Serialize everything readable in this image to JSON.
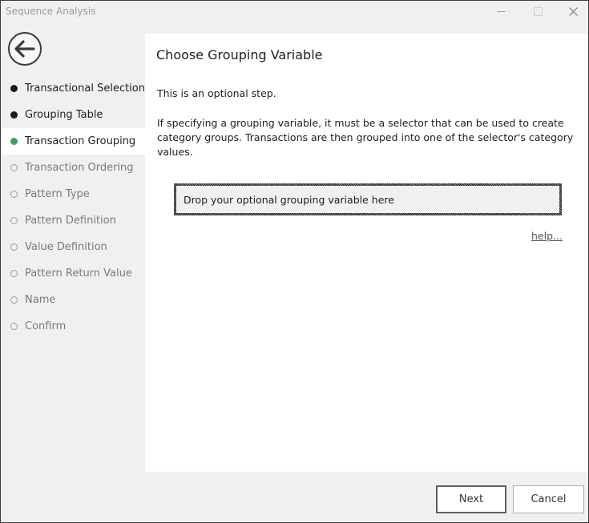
{
  "window": {
    "title": "Sequence Analysis"
  },
  "steps": [
    {
      "label": "Transactional Selection",
      "state": "done"
    },
    {
      "label": "Grouping Table",
      "state": "done"
    },
    {
      "label": "Transaction Grouping",
      "state": "current"
    },
    {
      "label": "Transaction Ordering",
      "state": "pending"
    },
    {
      "label": "Pattern Type",
      "state": "pending"
    },
    {
      "label": "Pattern Definition",
      "state": "pending"
    },
    {
      "label": "Value Definition",
      "state": "pending"
    },
    {
      "label": "Pattern Return Value",
      "state": "pending"
    },
    {
      "label": "Name",
      "state": "pending"
    },
    {
      "label": "Confirm",
      "state": "pending"
    }
  ],
  "content": {
    "title": "Choose Grouping Variable",
    "intro": "This is an optional step.",
    "description": "If specifying a grouping variable, it must be a selector that can be used to create category groups. Transactions are then grouped into one of the selector's category values.",
    "dropzone_text": "Drop your optional grouping variable here",
    "help_label": "help..."
  },
  "buttons": {
    "next": "Next",
    "cancel": "Cancel"
  },
  "colors": {
    "done_dot": "#1a1a1a",
    "current_dot": "#4a9a5f",
    "pending_dot": "#9c9c9c"
  },
  "icons": {
    "back": "back-arrow-icon",
    "minimize": "minimize-icon",
    "maximize": "maximize-icon",
    "close": "close-icon"
  }
}
